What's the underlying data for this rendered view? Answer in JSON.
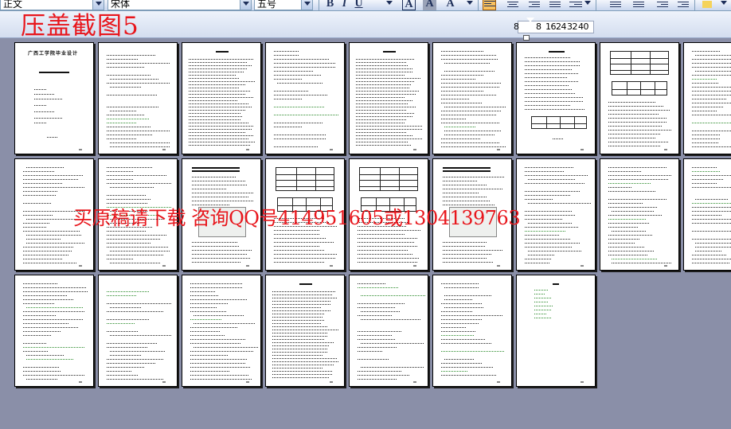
{
  "toolbar": {
    "style_value": "正文",
    "font_value": "宋体",
    "size_value": "五号",
    "bold_label": "B",
    "italic_label": "I",
    "underline_label": "U",
    "font_color_label": "A",
    "highlight_label": "A",
    "char_label": "A"
  },
  "banner": {
    "title": "压盖截图5"
  },
  "ruler": {
    "marks": [
      "8",
      "8",
      "16",
      "24",
      "32",
      "40"
    ]
  },
  "watermark": {
    "text": "买原稿请下载 咨询QQ号414951605或1304139763"
  },
  "pages": [
    {
      "index": 1,
      "title": "广西工学院毕业设计"
    },
    {
      "index": 2
    },
    {
      "index": 3
    },
    {
      "index": 4
    },
    {
      "index": 5
    },
    {
      "index": 6
    },
    {
      "index": 7
    },
    {
      "index": 8
    },
    {
      "index": 9
    },
    {
      "index": 10
    },
    {
      "index": 11
    },
    {
      "index": 12
    },
    {
      "index": 13
    },
    {
      "index": 14
    },
    {
      "index": 15
    },
    {
      "index": 16
    },
    {
      "index": 17
    },
    {
      "index": 18
    },
    {
      "index": 19
    },
    {
      "index": 20
    },
    {
      "index": 21
    },
    {
      "index": 22
    },
    {
      "index": 23
    },
    {
      "index": 24
    },
    {
      "index": 25
    }
  ],
  "colors": {
    "workspace": "#8a8fa8",
    "banner": "#e8161c",
    "page": "#ffffff"
  }
}
